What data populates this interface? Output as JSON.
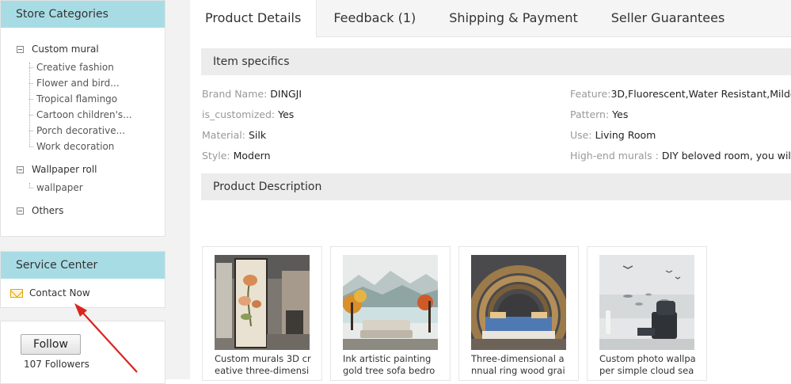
{
  "sidebar": {
    "categories_title": "Store Categories",
    "categories": [
      {
        "label": "Custom mural",
        "children": [
          "Creative fashion",
          "Flower and bird...",
          "Tropical flamingo",
          "Cartoon children's...",
          "Porch decorative...",
          "Work decoration"
        ]
      },
      {
        "label": "Wallpaper roll",
        "children": [
          "wallpaper"
        ]
      },
      {
        "label": "Others",
        "children": []
      }
    ],
    "service_title": "Service Center",
    "contact_label": "Contact Now",
    "follow_label": "Follow",
    "followers_text": "107 Followers"
  },
  "tabs": [
    "Product Details",
    "Feedback (1)",
    "Shipping & Payment",
    "Seller Guarantees"
  ],
  "item_specifics": {
    "title": "Item specifics",
    "left": [
      {
        "key": "Brand Name:",
        "value": "DINGJI"
      },
      {
        "key": "is_customized:",
        "value": "Yes"
      },
      {
        "key": "Material:",
        "value": "Silk"
      },
      {
        "key": "Style:",
        "value": "Modern"
      }
    ],
    "right": [
      {
        "key": "Feature:",
        "value": "3D,Fluorescent,Water Resistant,Milde"
      },
      {
        "key": "Pattern:",
        "value": "Yes"
      },
      {
        "key": "Use:",
        "value": "Living Room"
      },
      {
        "key": "High-end murals :",
        "value": "DIY beloved room, you will b"
      }
    ]
  },
  "description_title": "Product Description",
  "products": [
    {
      "caption": "Custom murals 3D creative three-dimensi"
    },
    {
      "caption": "Ink artistic painting gold tree sofa bedroo"
    },
    {
      "caption": "Three-dimensional annual ring wood grai"
    },
    {
      "caption": "Custom photo wallpaper simple cloud sea"
    }
  ],
  "colors": {
    "section_header": "#a8dce5",
    "arrow": "#d9251c"
  }
}
